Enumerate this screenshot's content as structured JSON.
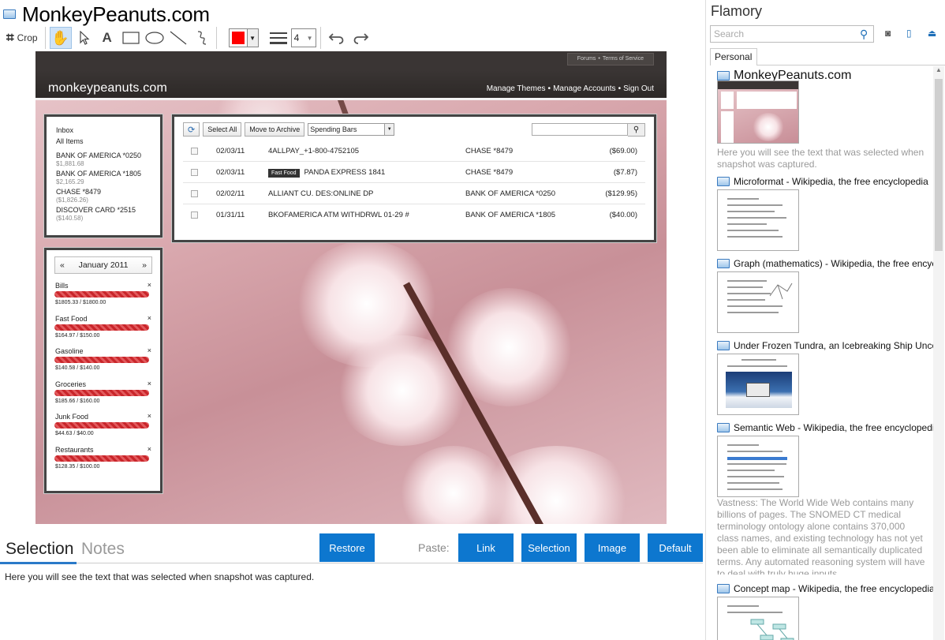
{
  "window": {
    "title": "MonkeyPeanuts.com"
  },
  "toolbar": {
    "crop": "Crop",
    "width_value": "4",
    "color": "#ff0000"
  },
  "screenshot": {
    "site_top_links": [
      "Forums",
      "•",
      "Terms of Service"
    ],
    "logo": "monkeypeanuts.com",
    "nav": [
      "Manage Themes",
      "•",
      "Manage Accounts",
      "•",
      "Sign Out"
    ],
    "accounts": {
      "links": [
        "Inbox",
        "All Items"
      ],
      "items": [
        {
          "name": "BANK OF AMERICA *0250",
          "amount": "$1,881.68"
        },
        {
          "name": "BANK OF AMERICA *1805",
          "amount": "$2,165.29"
        },
        {
          "name": "CHASE *8479",
          "amount": "($1,826.26)"
        },
        {
          "name": "DISCOVER CARD *2515",
          "amount": "($140.58)"
        }
      ]
    },
    "tx_toolbar": {
      "select_all": "Select All",
      "move_to_archive": "Move to Archive",
      "dropdown": "Spending Bars"
    },
    "transactions": [
      {
        "date": "02/03/11",
        "tag": "",
        "desc": "4ALLPAY_+1-800-4752105",
        "account": "CHASE *8479",
        "amount": "($69.00)"
      },
      {
        "date": "02/03/11",
        "tag": "Fast Food",
        "desc": "PANDA EXPRESS 1841",
        "account": "CHASE *8479",
        "amount": "($7.87)"
      },
      {
        "date": "02/02/11",
        "tag": "",
        "desc": "ALLIANT CU. DES:ONLINE DP",
        "account": "BANK OF AMERICA *0250",
        "amount": "($129.95)"
      },
      {
        "date": "01/31/11",
        "tag": "",
        "desc": "BKOFAMERICA ATM WITHDRWL 01-29 #",
        "account": "BANK OF AMERICA *1805",
        "amount": "($40.00)"
      }
    ],
    "month": {
      "prev": "«",
      "label": "January 2011",
      "next": "»"
    },
    "budgets": [
      {
        "name": "Bills",
        "value": "$1805.33 / $1800.00"
      },
      {
        "name": "Fast Food",
        "value": "$164.97 / $150.00"
      },
      {
        "name": "Gasoline",
        "value": "$140.58 / $140.00"
      },
      {
        "name": "Groceries",
        "value": "$185.66 / $160.00"
      },
      {
        "name": "Junk Food",
        "value": "$44.63 / $40.00"
      },
      {
        "name": "Restaurants",
        "value": "$128.35 / $100.00"
      }
    ],
    "remove": "×"
  },
  "bottom": {
    "tabs": [
      "Selection",
      "Notes"
    ],
    "restore": "Restore",
    "paste_label": "Paste:",
    "paste_buttons": [
      "Link",
      "Selection",
      "Image",
      "Default"
    ],
    "selection_text": "Here you will see the text that was selected when snapshot was captured."
  },
  "sidebar": {
    "app_name": "Flamory",
    "search_placeholder": "Search",
    "tab": "Personal",
    "items": [
      {
        "title": "MonkeyPeanuts.com",
        "desc": "Here you will see the text that was selected when snapshot was captured."
      },
      {
        "title": "Microformat - Wikipedia, the free encyclopedia",
        "desc": ""
      },
      {
        "title": "Graph (mathematics) - Wikipedia, the free encyclopedia",
        "desc": ""
      },
      {
        "title": "Under Frozen Tundra, an Icebreaking Ship Uncovers",
        "desc": ""
      },
      {
        "title": "Semantic Web - Wikipedia, the free encyclopedia",
        "desc": "Vastness: The World Wide Web contains many billions of pages. The SNOMED CT medical terminology ontology alone contains 370,000 class names, and existing technology has not yet been able to eliminate all semantically duplicated terms. Any automated reasoning system will have to deal with truly huge inputs."
      },
      {
        "title": "Concept map - Wikipedia, the free encyclopedia",
        "desc": ""
      }
    ]
  },
  "colors": {
    "accent": "#0d77cf",
    "tab_underline": "#2a7ac8"
  }
}
